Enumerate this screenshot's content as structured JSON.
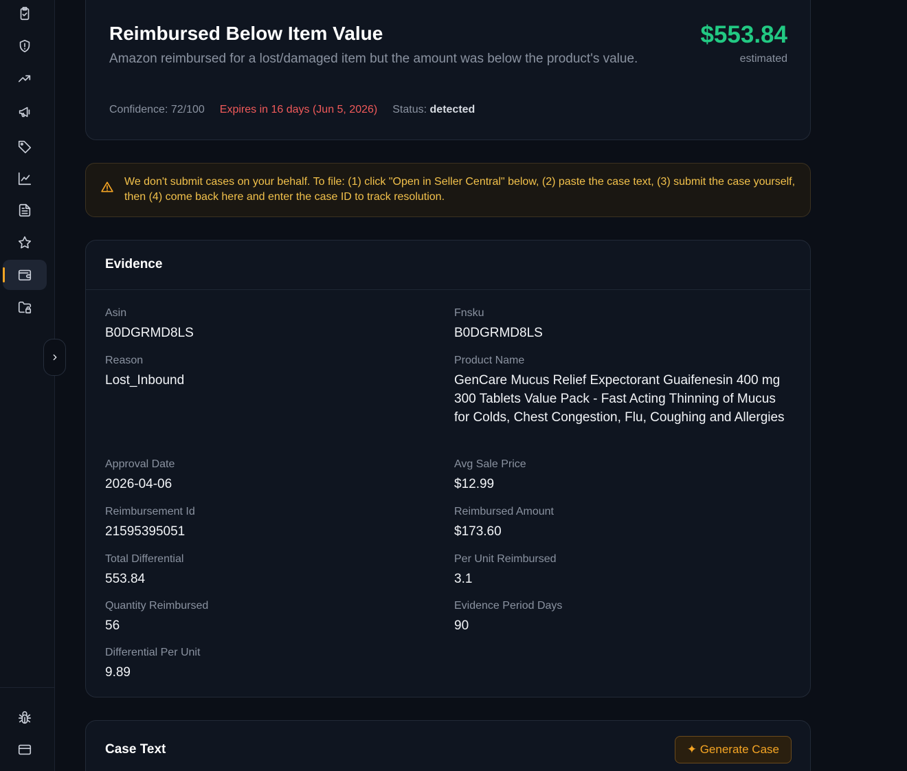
{
  "sidebar": {
    "items": [
      {
        "icon": "clipboard-check-icon",
        "label": ""
      },
      {
        "icon": "shield-alert-icon",
        "label": ""
      },
      {
        "icon": "trending-up-icon",
        "label": ""
      },
      {
        "icon": "megaphone-icon",
        "label": ""
      },
      {
        "icon": "tag-icon",
        "label": ""
      },
      {
        "icon": "line-chart-icon",
        "label": ""
      },
      {
        "icon": "file-text-icon",
        "label": ""
      },
      {
        "icon": "star-icon",
        "label": ""
      },
      {
        "icon": "wallet-icon",
        "label": "",
        "active": true
      },
      {
        "icon": "folder-lock-icon",
        "label": ""
      }
    ],
    "bottom_items": [
      {
        "icon": "bug-icon"
      },
      {
        "icon": "credit-card-icon"
      }
    ],
    "accent_color": "#f5a524"
  },
  "header": {
    "title": "Reimbursed Below Item Value",
    "description": "Amazon reimbursed for a lost/damaged item but the amount was below the product's value.",
    "amount": "$553.84",
    "amount_caption": "estimated",
    "amount_color": "#22c983",
    "confidence": "Confidence: 72/100",
    "expires": "Expires in 16 days (Jun 5, 2026)",
    "status_label": "Status:",
    "status_value": "detected"
  },
  "notice": {
    "icon": "warning-triangle-icon",
    "text": "We don't submit cases on your behalf. To file: (1) click \"Open in Seller Central\" below, (2) paste the case text, (3) submit the case yourself, then (4) come back here and enter the case ID to track resolution."
  },
  "evidence": {
    "title": "Evidence",
    "fields": {
      "asin": {
        "label": "Asin",
        "value": "B0DGRMD8LS"
      },
      "fnsku": {
        "label": "Fnsku",
        "value": "B0DGRMD8LS"
      },
      "reason": {
        "label": "Reason",
        "value": "Lost_Inbound"
      },
      "product_name": {
        "label": "Product Name",
        "value": "GenCare Mucus Relief Expectorant Guaifenesin 400 mg 300 Tablets Value Pack - Fast Acting Thinning of Mucus for Colds, Chest Congestion, Flu, Coughing and Allergies"
      },
      "approval_date": {
        "label": "Approval Date",
        "value": "2026-04-06"
      },
      "avg_sale_price": {
        "label": "Avg Sale Price",
        "value": "$12.99"
      },
      "reimbursement_id": {
        "label": "Reimbursement Id",
        "value": "21595395051"
      },
      "reimbursed_amount": {
        "label": "Reimbursed Amount",
        "value": "$173.60"
      },
      "total_differential": {
        "label": "Total Differential",
        "value": "553.84"
      },
      "per_unit_reimbursed": {
        "label": "Per Unit Reimbursed",
        "value": "3.1"
      },
      "quantity_reimbursed": {
        "label": "Quantity Reimbursed",
        "value": "56"
      },
      "evidence_period_days": {
        "label": "Evidence Period Days",
        "value": "90"
      },
      "differential_per_unit": {
        "label": "Differential Per Unit",
        "value": "9.89"
      }
    }
  },
  "case_text": {
    "title": "Case Text",
    "generate_button": "✦ Generate Case"
  }
}
